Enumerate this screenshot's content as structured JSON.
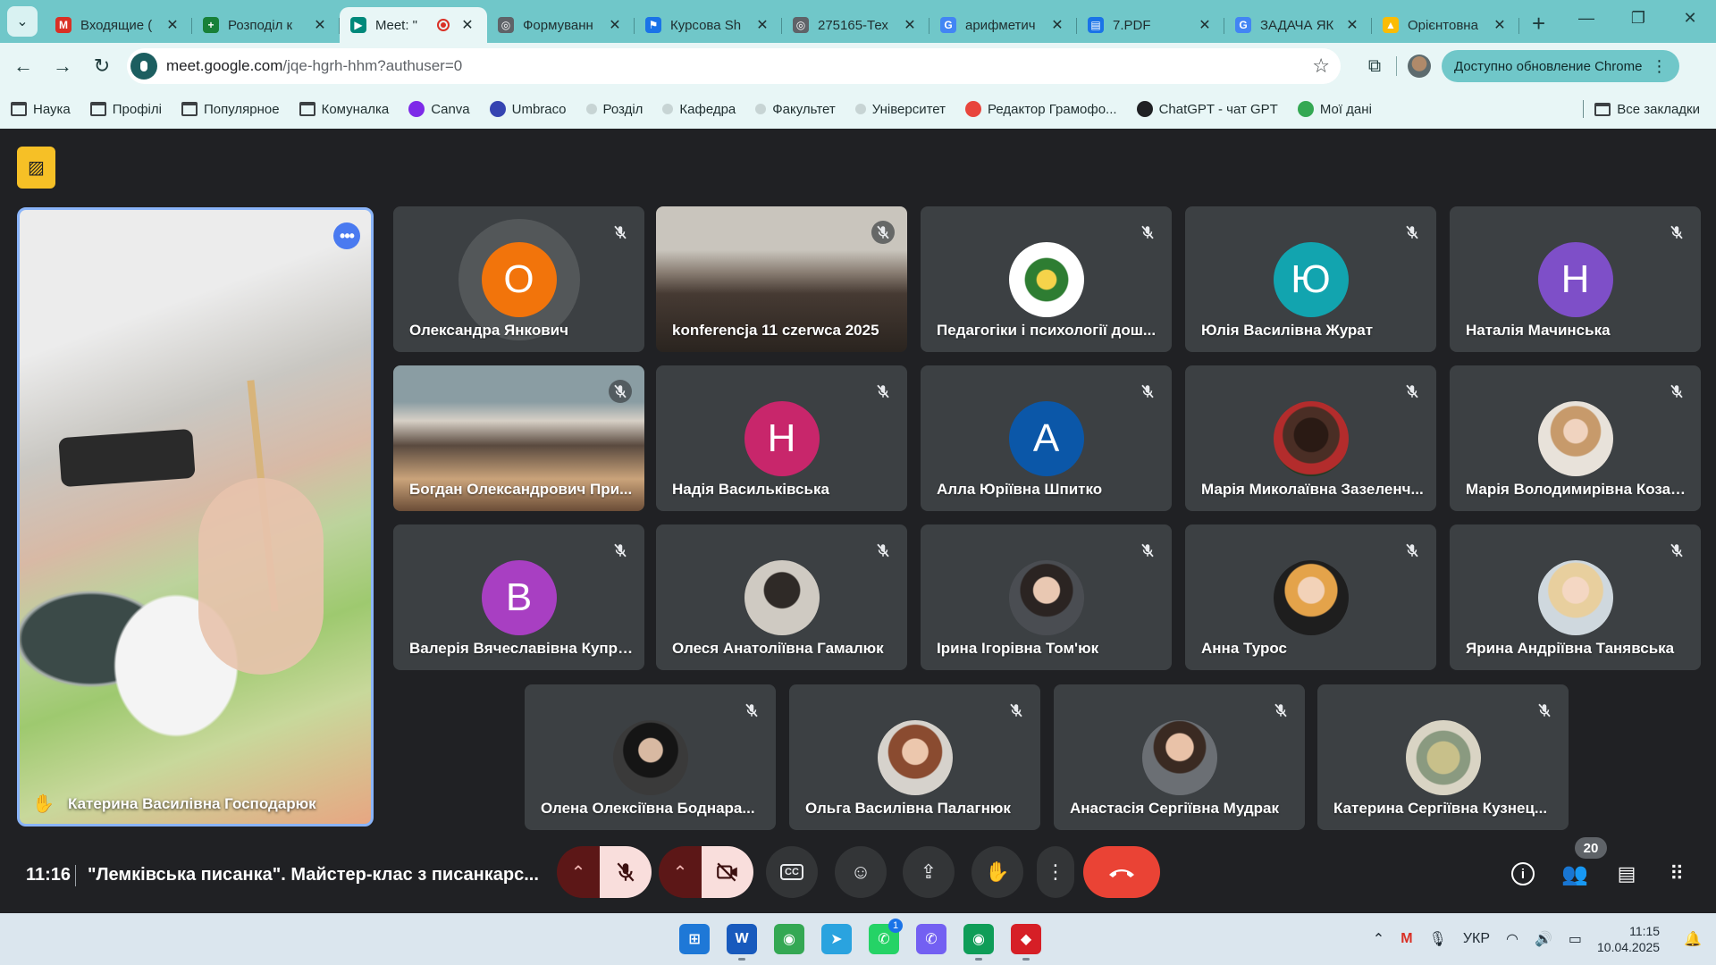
{
  "browser": {
    "tabs": [
      {
        "title": "Входящие (",
        "favicon_color": "#d93025",
        "favicon_glyph": "M"
      },
      {
        "title": "Розподіл к",
        "favicon_color": "#188038",
        "favicon_glyph": "+"
      },
      {
        "title": "Meet: \"",
        "favicon_color": "#00897b",
        "favicon_glyph": "▶",
        "active": true
      },
      {
        "title": "Формуванн",
        "favicon_color": "#5f6368",
        "favicon_glyph": "◎"
      },
      {
        "title": "Курсова Sh",
        "favicon_color": "#1a73e8",
        "favicon_glyph": "⚑"
      },
      {
        "title": "275165-Тех",
        "favicon_color": "#5f6368",
        "favicon_glyph": "◎"
      },
      {
        "title": "арифметич",
        "favicon_color": "#4285f4",
        "favicon_glyph": "G"
      },
      {
        "title": "7.PDF",
        "favicon_color": "#1a73e8",
        "favicon_glyph": "▤"
      },
      {
        "title": "ЗАДАЧА ЯК",
        "favicon_color": "#4285f4",
        "favicon_glyph": "G"
      },
      {
        "title": "Орієнтовна",
        "favicon_color": "#fbbc04",
        "favicon_glyph": "▲"
      }
    ],
    "url_host": "meet.google.com",
    "url_path": "/jqe-hgrh-hhm?authuser=0",
    "update_label": "Доступно обновление Chrome",
    "bookmarks": [
      {
        "label": "Наука",
        "icon": "folder-icon"
      },
      {
        "label": "Профілі",
        "icon": "folder-icon"
      },
      {
        "label": "Популярное",
        "icon": "folder-icon"
      },
      {
        "label": "Комуналка",
        "icon": "folder-icon"
      },
      {
        "label": "Canva",
        "icon": "canva-icon",
        "color": "#7d2ae8"
      },
      {
        "label": "Umbraco",
        "icon": "umbraco-icon",
        "color": "#3544b1"
      },
      {
        "label": "Розділ",
        "icon": "globe-icon"
      },
      {
        "label": "Кафедра",
        "icon": "globe-icon"
      },
      {
        "label": "Факультет",
        "icon": "globe-icon"
      },
      {
        "label": "Університет",
        "icon": "globe-icon"
      },
      {
        "label": "Редактор Грамофо...",
        "icon": "grammophone-icon",
        "color": "#e8453c"
      },
      {
        "label": "ChatGPT - чат GPT",
        "icon": "chatgpt-icon",
        "color": "#202124"
      },
      {
        "label": "Мої дані",
        "icon": "earth-icon",
        "color": "#34a853"
      }
    ],
    "all_bookmarks_label": "Все закладки"
  },
  "meet": {
    "pinned": {
      "name": "Катерина Василівна Господарюк"
    },
    "tiles": [
      {
        "name": "Олександра Янкович",
        "kind": "letter",
        "letter": "О",
        "color": "#f2740b",
        "halo": true
      },
      {
        "name": "konferencja 11 czerwca 2025",
        "kind": "video",
        "style": "video-room1"
      },
      {
        "name": "Педагогіки і психології дош...",
        "kind": "photo",
        "style": "crest"
      },
      {
        "name": "Юлія Василівна Журат",
        "kind": "letter",
        "letter": "Ю",
        "color": "#12a4af"
      },
      {
        "name": "Наталія Мачинська",
        "kind": "letter",
        "letter": "Н",
        "color": "#7e4fc8"
      },
      {
        "name": "Богдан Олександрович При...",
        "kind": "video",
        "style": "video-room2"
      },
      {
        "name": "Надія Васильківська",
        "kind": "letter",
        "letter": "Н",
        "color": "#c8266b"
      },
      {
        "name": "Алла Юріївна Шпитко",
        "kind": "letter",
        "letter": "А",
        "color": "#0b57a8"
      },
      {
        "name": "Марія Миколаївна Зазеленч...",
        "kind": "photo",
        "style": "photo-j"
      },
      {
        "name": "Марія Володимирівна Козак...",
        "kind": "photo",
        "style": "photo-b"
      },
      {
        "name": "Валерія Вячеславівна Купрі...",
        "kind": "letter",
        "letter": "В",
        "color": "#a83fc2"
      },
      {
        "name": "Олеся Анатоліївна Гамалюк",
        "kind": "photo",
        "style": "photo-k"
      },
      {
        "name": "Ірина Ігорівна Том'юк",
        "kind": "photo",
        "style": "photo-f"
      },
      {
        "name": "Анна Турос",
        "kind": "photo",
        "style": "photo-d"
      },
      {
        "name": "Ярина Андріївна Танявська",
        "kind": "photo",
        "style": "photo-e"
      },
      {
        "name": "Олена Олексіївна Боднара...",
        "kind": "photo",
        "style": "photo-h"
      },
      {
        "name": "Ольга Василівна Палагнюк",
        "kind": "photo",
        "style": "photo-g"
      },
      {
        "name": "Анастасія Сергіївна Мудрак",
        "kind": "photo",
        "style": "photo-c"
      },
      {
        "name": "Катерина Сергіївна Кузнец...",
        "kind": "photo",
        "style": "photo-i"
      }
    ],
    "time": "11:16",
    "meeting_title": "\"Лемківська писанка\". Майстер-клас з писанкарс...",
    "participants_count": "20",
    "colors": {
      "accent": "#8ab4f8",
      "end_call": "#ea4335",
      "muted_bg": "#f9dedc",
      "tile_bg": "#3c4043"
    }
  },
  "taskbar": {
    "apps": [
      {
        "name": "windows-start-icon",
        "color": "#1e78d7",
        "glyph": "⊞"
      },
      {
        "name": "word-icon",
        "color": "#185abd",
        "glyph": "W"
      },
      {
        "name": "chrome-icon",
        "color": "#34a853",
        "glyph": "◉"
      },
      {
        "name": "telegram-icon",
        "color": "#2aa3df",
        "glyph": "➤"
      },
      {
        "name": "whatsapp-icon",
        "color": "#25d366",
        "glyph": "✆"
      },
      {
        "name": "viber-icon",
        "color": "#7360f2",
        "glyph": "✆"
      },
      {
        "name": "chrome-profile-icon",
        "color": "#0f9d58",
        "glyph": "◉"
      },
      {
        "name": "anydesk-icon",
        "color": "#d61f26",
        "glyph": "◆"
      }
    ],
    "whatsapp_badge": "1",
    "lang": "УКР",
    "clock_time": "11:15",
    "clock_date": "10.04.2025"
  }
}
